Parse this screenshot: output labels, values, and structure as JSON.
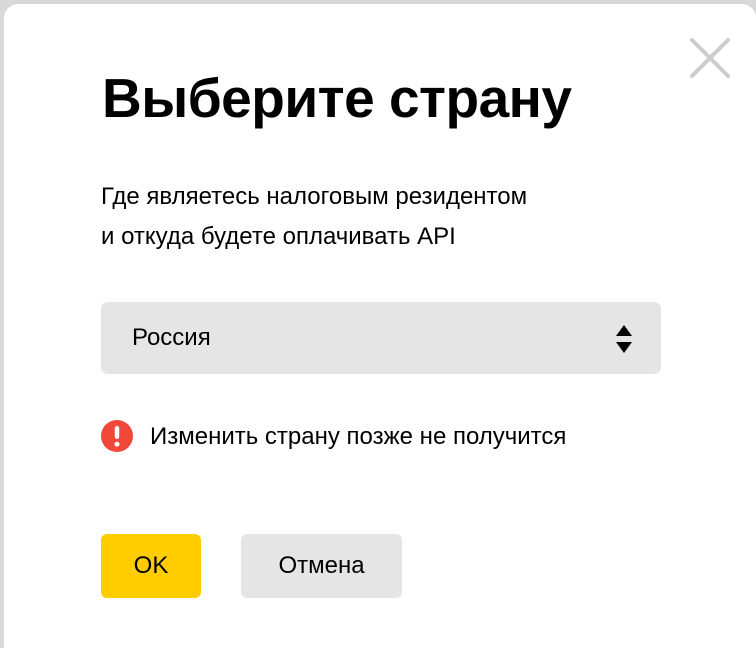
{
  "dialog": {
    "title": "Выберите страну",
    "description_lines": [
      "Где являетесь налоговым резидентом",
      "и откуда будете оплачивать API"
    ],
    "country_select": {
      "selected_value": "Россия"
    },
    "warning": {
      "text": "Изменить страну позже не получится",
      "icon": "exclamation-circle-icon"
    },
    "buttons": {
      "ok_label": "OK",
      "cancel_label": "Отмена"
    },
    "close_icon": "close-icon"
  },
  "colors": {
    "primary_button": "#ffcc00",
    "secondary_button": "#e5e5e5",
    "select_background": "#e5e5e5",
    "warning_icon": "#f2483a",
    "close_icon": "#cccccc",
    "backdrop": "#d9d9d9",
    "dialog_background": "#ffffff"
  }
}
